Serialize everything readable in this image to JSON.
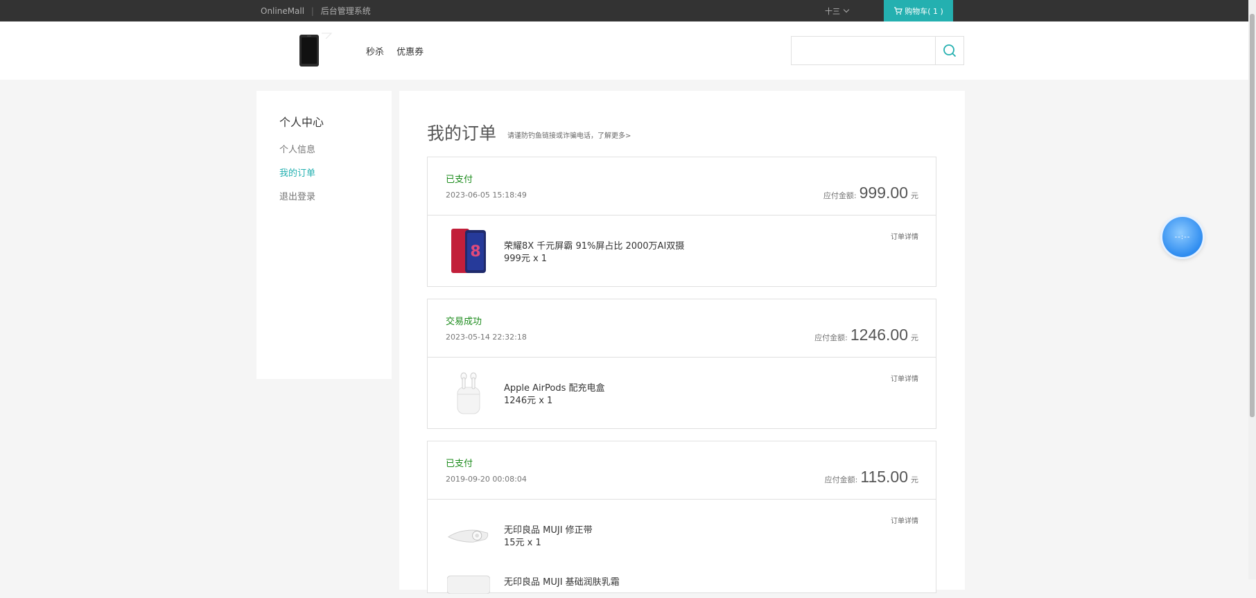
{
  "topbar": {
    "site": "OnlineMall",
    "sep": "|",
    "admin": "后台管理系统",
    "user": "十三",
    "cart": "购物车( 1 )"
  },
  "header": {
    "nav": [
      "秒杀",
      "优惠券"
    ],
    "search_placeholder": ""
  },
  "sidebar": {
    "title": "个人中心",
    "items": [
      {
        "label": "个人信息",
        "active": false
      },
      {
        "label": "我的订单",
        "active": true
      },
      {
        "label": "退出登录",
        "active": false
      }
    ]
  },
  "main": {
    "title": "我的订单",
    "notice": "请谨防钓鱼链接或诈骗电话，了解更多>",
    "amount_label": "应付金额:",
    "currency": "元",
    "detail_label": "订单详情",
    "orders": [
      {
        "status": "已支付",
        "time": "2023-06-05 15:18:49",
        "amount": "999.00",
        "product": "荣耀8X 千元屏霸 91%屏占比 2000万AI双摄",
        "price_qty": "999元 x 1"
      },
      {
        "status": "交易成功",
        "time": "2023-05-14 22:32:18",
        "amount": "1246.00",
        "product": "Apple AirPods 配充电盒",
        "price_qty": "1246元 x 1"
      },
      {
        "status": "已支付",
        "time": "2019-09-20 00:08:04",
        "amount": "115.00",
        "product": "无印良品 MUJI 修正带",
        "price_qty": "15元 x 1",
        "product2": "无印良品 MUJI 基础润肤乳霜"
      }
    ]
  },
  "float_ball": {
    "text": "--:--"
  },
  "colors": {
    "accent": "#24b0b0",
    "status_green": "#1a8a1a",
    "topbar": "#333333"
  }
}
